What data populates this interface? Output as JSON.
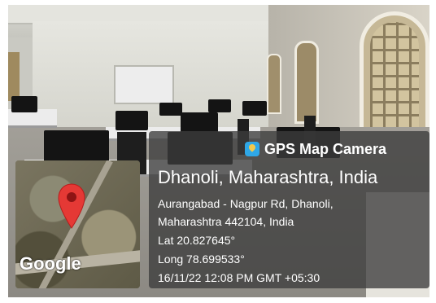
{
  "badge": {
    "icon": "gps-map-camera-app-icon",
    "label": "GPS Map Camera"
  },
  "map": {
    "watermark": "Google",
    "marker_icon": "location-pin-icon",
    "marker_color": "#e53935"
  },
  "location": {
    "title": "Dhanoli, Maharashtra, India",
    "address_line1": "Aurangabad - Nagpur Rd, Dhanoli,",
    "address_line2": "Maharashtra 442104, India",
    "latitude": "Lat 20.827645°",
    "longitude": "Long 78.699533°",
    "timestamp": "16/11/22 12:08 PM GMT +05:30"
  }
}
